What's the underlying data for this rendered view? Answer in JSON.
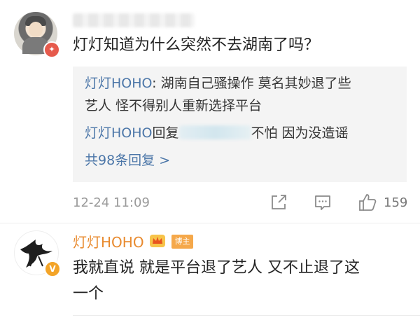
{
  "comments": [
    {
      "text": "灯灯知道为什么突然不去湖南了吗？",
      "badge_icon": "vip-badge-icon",
      "replies": [
        {
          "name": "灯灯HOHO",
          "text_line1": ": 湖南自己骚操作 莫名其妙退了些",
          "text_line2": "艺人 怪不得别人重新选择平台"
        },
        {
          "name": "灯灯HOHO",
          "prefix": "回复",
          "suffix": "不怕 因为没造谣"
        }
      ],
      "reply_count_label": "共98条回复 >",
      "timestamp": "12-24 11:09",
      "like_count": "159",
      "actions": [
        "share-icon",
        "comment-icon",
        "like-icon"
      ]
    },
    {
      "username": "灯灯HOHO",
      "badge_label": "博主",
      "text_line1": "我就直说 就是平台退了艺人 又不止退了这",
      "text_line2": "一个"
    }
  ],
  "colors": {
    "link_blue": "#4b76a8",
    "username_orange": "#e88a2e",
    "reply_bg": "#f4f4f4",
    "meta_gray": "#9a9a9a"
  }
}
